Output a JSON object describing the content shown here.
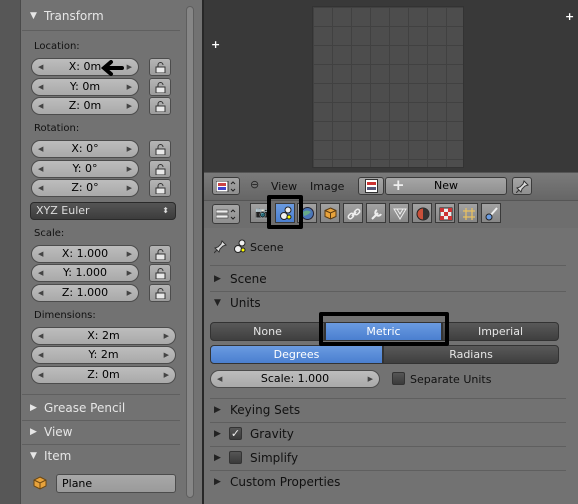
{
  "transform": {
    "title": "Transform",
    "location_label": "Location:",
    "location": [
      "X: 0m",
      "Y: 0m",
      "Z: 0m"
    ],
    "rotation_label": "Rotation:",
    "rotation": [
      "X: 0°",
      "Y: 0°",
      "Z: 0°"
    ],
    "rotation_mode": "XYZ Euler",
    "scale_label": "Scale:",
    "scale": [
      "X: 1.000",
      "Y: 1.000",
      "Z: 1.000"
    ],
    "dimensions_label": "Dimensions:",
    "dimensions": [
      "X: 2m",
      "Y: 2m",
      "Z: 0m"
    ]
  },
  "left_panels": {
    "grease_pencil": "Grease Pencil",
    "view": "View",
    "item": "Item",
    "item_name": "Plane"
  },
  "image_header": {
    "view_menu": "View",
    "image_menu": "Image",
    "new_button": "New"
  },
  "properties": {
    "context_name": "Scene",
    "scene_section": "Scene",
    "units_section": "Units",
    "unit_systems": [
      "None",
      "Metric",
      "Imperial"
    ],
    "active_unit_system": "Metric",
    "rotation_units": [
      "Degrees",
      "Radians"
    ],
    "active_rotation_unit": "Degrees",
    "scale_field": "Scale: 1.000",
    "separate_units_label": "Separate Units",
    "separate_units_checked": false,
    "keying_sets_section": "Keying Sets",
    "gravity_section": "Gravity",
    "gravity_checked": true,
    "simplify_section": "Simplify",
    "simplify_checked": false,
    "custom_properties_section": "Custom Properties"
  },
  "colors": {
    "selected_blue": "#5a8ad6",
    "panel_bg": "#727272",
    "header_bg": "#575757"
  }
}
